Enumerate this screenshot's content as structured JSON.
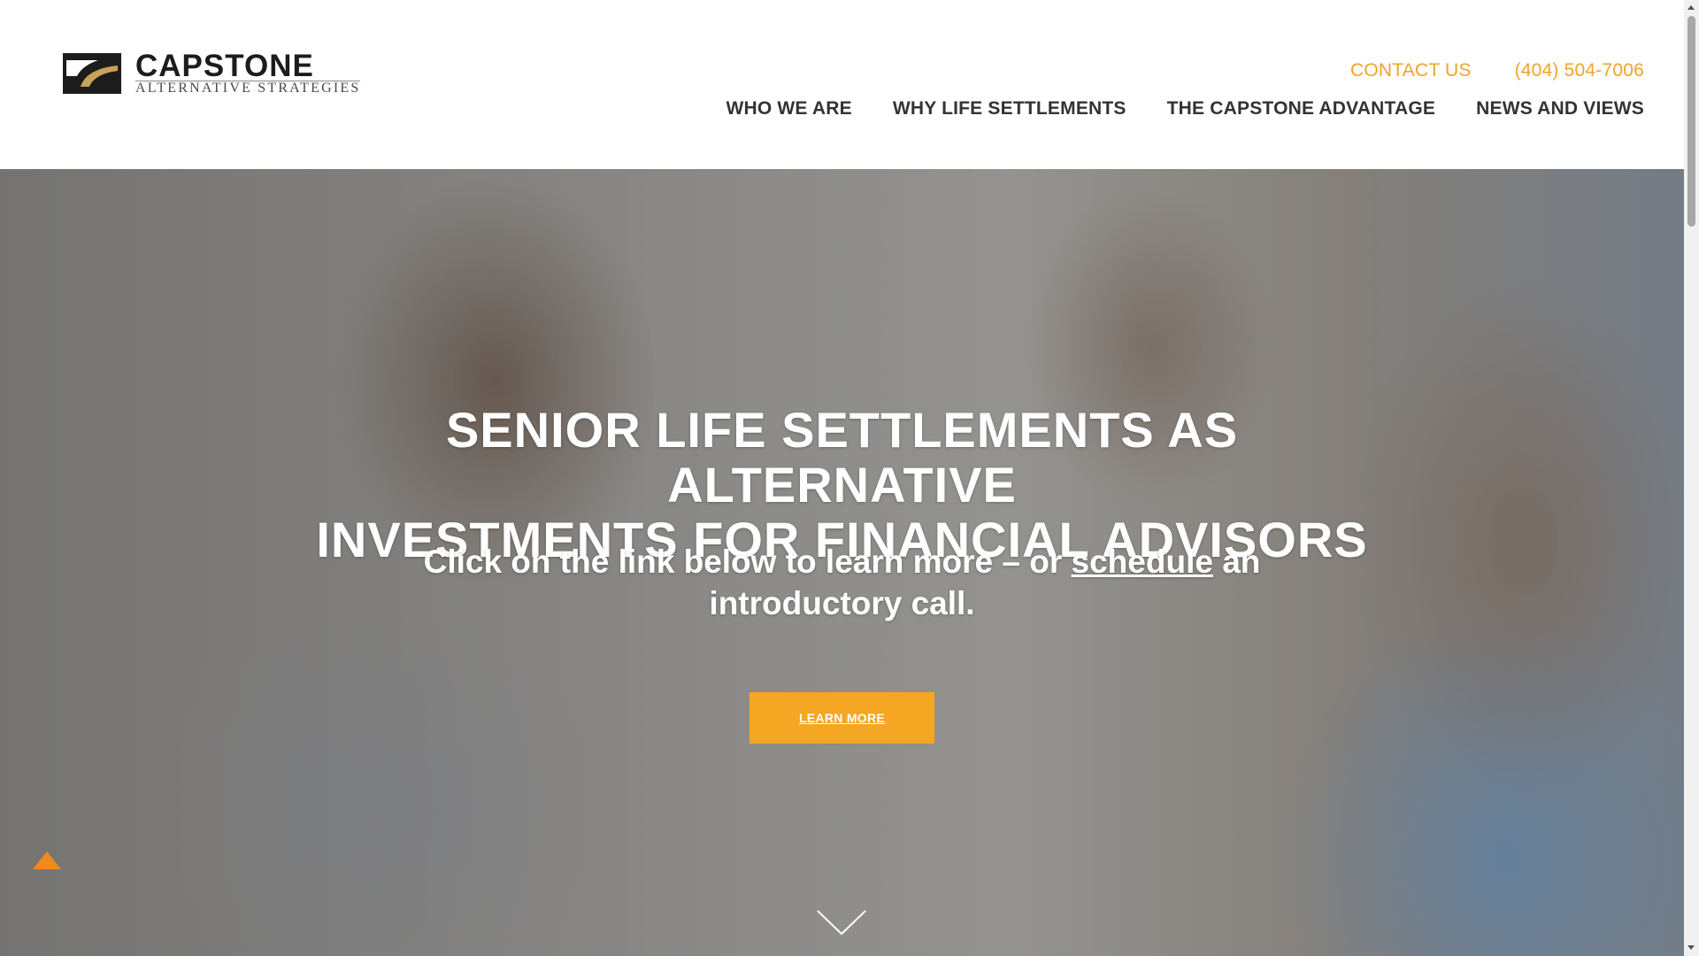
{
  "logo": {
    "name": "CAPSTONE",
    "tagline": "ALTERNATIVE STRATEGIES"
  },
  "utility_nav": {
    "contact": "CONTACT US",
    "phone": "(404) 504-7006"
  },
  "main_nav": {
    "items": [
      {
        "label": "WHO WE ARE"
      },
      {
        "label": "WHY LIFE SETTLEMENTS"
      },
      {
        "label": "THE CAPSTONE ADVANTAGE"
      },
      {
        "label": "NEWS AND VIEWS"
      }
    ]
  },
  "hero": {
    "title_line1": "SENIOR LIFE SETTLEMENTS AS ALTERNATIVE",
    "title_line2": "INVESTMENTS FOR FINANCIAL ADVISORS",
    "sub_before": "Click on the link below to learn more – or ",
    "sub_link": "schedule",
    "sub_after": " an introductory call.",
    "cta_label": "LEARN MORE"
  },
  "icons": {
    "scroll_down": "chevron-down-icon",
    "logo_mark": "capstone-logo-icon"
  },
  "colors": {
    "accent": "#f5a623",
    "utility_link": "#f2a22b",
    "nav_text": "#333333"
  }
}
